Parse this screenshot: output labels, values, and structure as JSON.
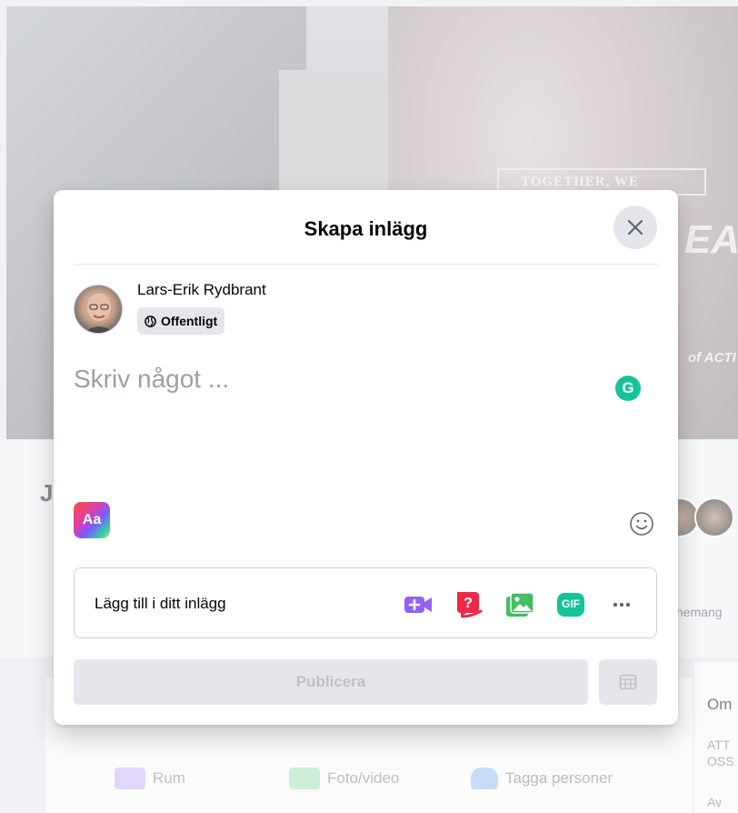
{
  "background": {
    "cover_sign_text": "TOGETHER, WE",
    "cover_overlay_text": "EA",
    "cover_bottom_text": "of ACTI",
    "profile_initial": "J",
    "menu_more_label": "hemang",
    "composer_actions": [
      {
        "label": "Rum",
        "icon": "video-room-icon"
      },
      {
        "label": "Foto/video",
        "icon": "photo-icon"
      },
      {
        "label": "Tagga personer",
        "icon": "tag-people-icon"
      }
    ],
    "about_card": {
      "title": "Om",
      "line1": "ATT",
      "line2": "OSS",
      "line3": "Av"
    }
  },
  "modal": {
    "title": "Skapa inlägg",
    "close_icon": "close-icon",
    "author": {
      "name": "Lars-Erik Rydbrant",
      "privacy_label": "Offentligt",
      "privacy_icon": "globe-icon"
    },
    "post_input": {
      "placeholder": "Skriv något ...",
      "value": ""
    },
    "text_style_label": "Aa",
    "grammarly_letter": "G",
    "add_to_post": {
      "label": "Lägg till i ditt inlägg",
      "icons": [
        "live-video-icon",
        "question-icon",
        "photo-icon",
        "gif-icon",
        "more-icon"
      ],
      "gif_label": "GIF"
    },
    "publish_label": "Publicera",
    "schedule_icon": "calendar-icon"
  },
  "colors": {
    "accent_green": "#45bd62",
    "purple": "#9360f7",
    "red": "#f02849",
    "teal": "#15c39a",
    "disabled_bg": "#e4e6eb",
    "disabled_text": "#bcc0c4"
  }
}
